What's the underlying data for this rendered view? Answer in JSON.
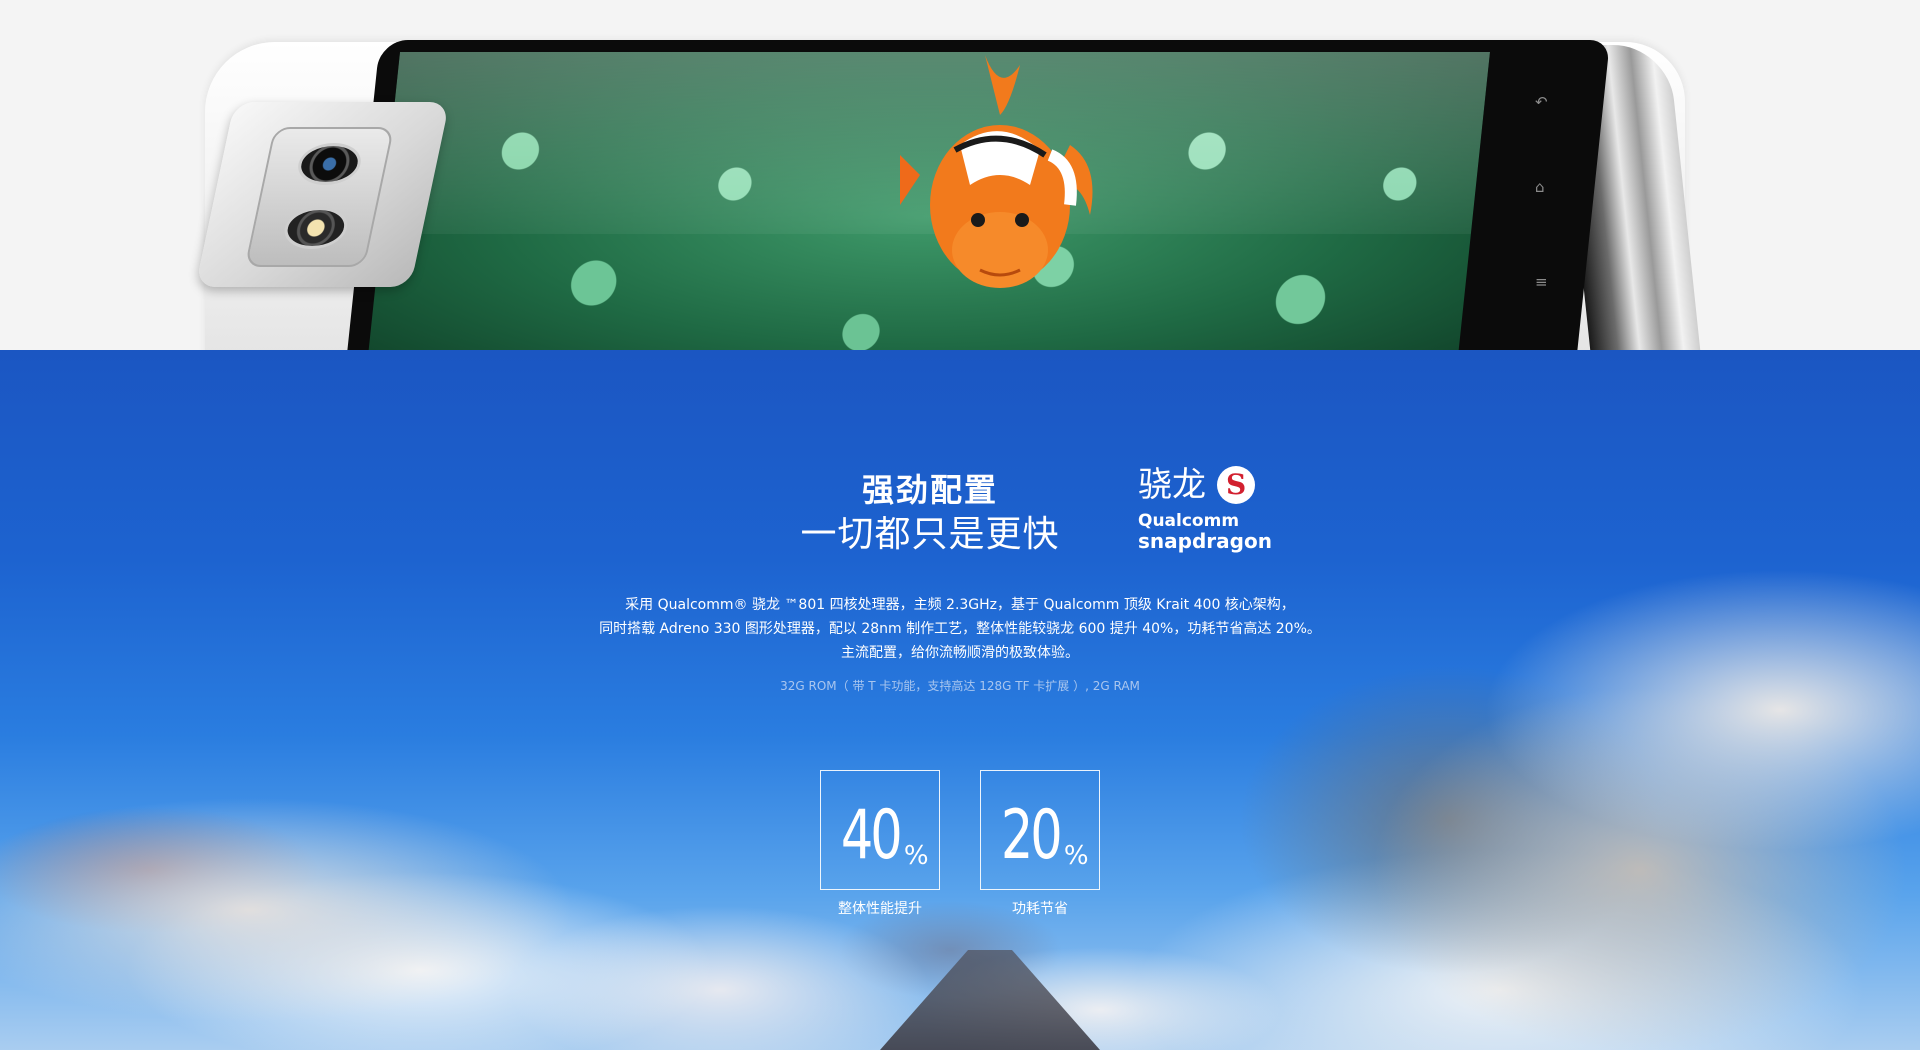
{
  "headline": {
    "line1": "强劲配置",
    "line2": "一切都只是更快"
  },
  "brand": {
    "name_cn": "骁龙",
    "logo_letter": "S",
    "name_en_1": "Qualcomm",
    "name_en_2": "snapdragon"
  },
  "description": {
    "line1": "采用 Qualcomm® 骁龙 ™801 四核处理器，主频 2.3GHz，基于 Qualcomm 顶级 Krait 400 核心架构，",
    "line2": "同时搭载 Adreno 330 图形处理器，配以 28nm 制作工艺，整体性能较骁龙 600 提升 40%，功耗节省高达 20%。",
    "line3": "主流配置，给你流畅顺滑的极致体验。"
  },
  "spec": "32G ROM（ 带 T 卡功能，支持高达 128G TF 卡扩展 ）, 2G RAM",
  "stats": [
    {
      "value": "40",
      "unit": "%",
      "label": "整体性能提升"
    },
    {
      "value": "20",
      "unit": "%",
      "label": "功耗节省"
    }
  ],
  "phone_nav": {
    "back_icon": "↶",
    "home_icon": "⌂",
    "menu_icon": "≡"
  },
  "colors": {
    "section_blue": "#1d63d0",
    "brand_red": "#d2202f"
  }
}
